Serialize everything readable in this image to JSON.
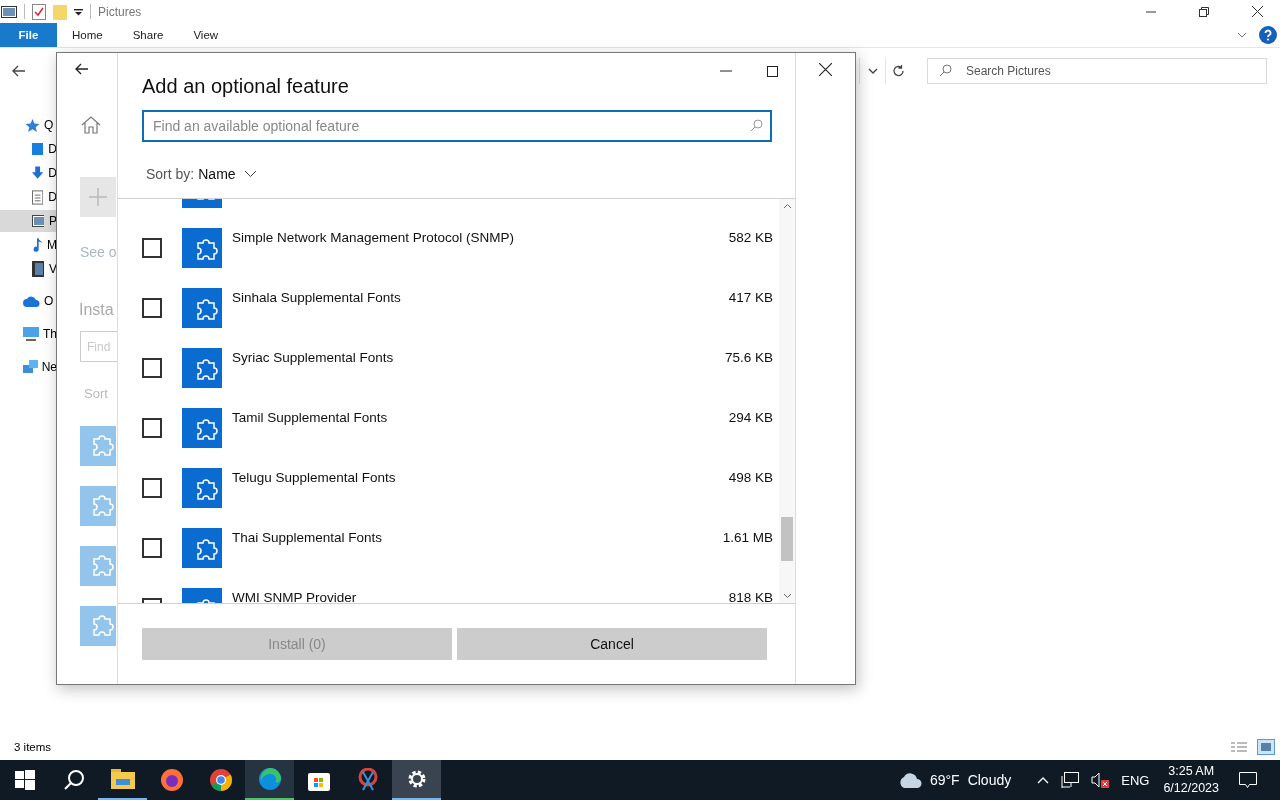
{
  "explorer": {
    "title": "Pictures",
    "ribbon_tabs": [
      {
        "label": "File",
        "kind": "file"
      },
      {
        "label": "Home",
        "kind": "tab"
      },
      {
        "label": "Share",
        "kind": "tab"
      },
      {
        "label": "View",
        "kind": "tab"
      }
    ],
    "search": {
      "placeholder": "Search Pictures"
    },
    "nav": [
      {
        "label": "Q",
        "kind": "star",
        "selected": false,
        "children": [
          {
            "label": "D",
            "kind": "desktop",
            "selected": false
          },
          {
            "label": "D",
            "kind": "download",
            "selected": false
          },
          {
            "label": "D",
            "kind": "document",
            "selected": false
          },
          {
            "label": "P",
            "kind": "pictures",
            "selected": true
          },
          {
            "label": "M",
            "kind": "music",
            "selected": false
          },
          {
            "label": "V",
            "kind": "video",
            "selected": false
          }
        ]
      },
      {
        "label": "O",
        "kind": "cloud",
        "selected": false
      },
      {
        "label": "Th",
        "kind": "pc",
        "selected": false
      },
      {
        "label": "Ne",
        "kind": "network",
        "selected": false
      }
    ],
    "status": "3 items"
  },
  "settings": {
    "link": "See o",
    "heading": "Insta",
    "search": {
      "placeholder": "Find"
    },
    "sort": "Sort"
  },
  "dialog": {
    "title": "Add an optional feature",
    "search": {
      "placeholder": "Find an available optional feature"
    },
    "sort_label": "Sort by:",
    "sort_value": "Name",
    "features": [
      {
        "name": "Simple Network Management Protocol (SNMP)",
        "size": "582 KB",
        "checked": false
      },
      {
        "name": "Sinhala Supplemental Fonts",
        "size": "417 KB",
        "checked": false
      },
      {
        "name": "Syriac Supplemental Fonts",
        "size": "75.6 KB",
        "checked": false
      },
      {
        "name": "Tamil Supplemental Fonts",
        "size": "294 KB",
        "checked": false
      },
      {
        "name": "Telugu Supplemental Fonts",
        "size": "498 KB",
        "checked": false
      },
      {
        "name": "Thai Supplemental Fonts",
        "size": "1.61 MB",
        "checked": false
      },
      {
        "name": "WMI SNMP Provider",
        "size": "818 KB",
        "checked": false
      }
    ],
    "buttons": [
      {
        "label": "Install (0)",
        "disabled": true
      },
      {
        "label": "Cancel",
        "disabled": false
      }
    ]
  },
  "taskbar": {
    "apps": [
      {
        "kind": "start",
        "running": false,
        "focused": false
      },
      {
        "kind": "search",
        "running": false,
        "focused": false
      },
      {
        "kind": "explorer",
        "running": true,
        "focused": false
      },
      {
        "kind": "firefox",
        "running": false,
        "focused": false
      },
      {
        "kind": "chrome",
        "running": false,
        "focused": false
      },
      {
        "kind": "edge",
        "running": true,
        "focused": true
      },
      {
        "kind": "store",
        "running": false,
        "focused": false
      },
      {
        "kind": "snip",
        "running": false,
        "focused": false
      },
      {
        "kind": "settings",
        "running": true,
        "focused": true
      }
    ],
    "temperature": "69°F",
    "weather": "Cloudy",
    "language": "ENG",
    "time": "3:25 AM",
    "date": "6/12/2023"
  }
}
